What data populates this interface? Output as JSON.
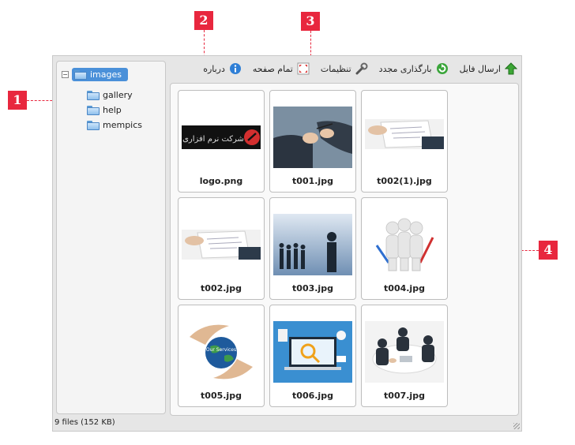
{
  "callouts": [
    "1",
    "2",
    "3",
    "4"
  ],
  "tree": {
    "root": "images",
    "expander": "−",
    "children": [
      "gallery",
      "help",
      "mempics"
    ]
  },
  "toolbar": {
    "upload_label": "ارسال فایل",
    "reload_label": "بارگذاری مجدد",
    "settings_label": "تنظیمات",
    "fullscreen_label": "تمام صفحه",
    "about_label": "درباره"
  },
  "files": [
    {
      "name": "logo.png",
      "thumb": "logo"
    },
    {
      "name": "t001.jpg",
      "thumb": "hands-pen"
    },
    {
      "name": "t002(1).jpg",
      "thumb": "hands-doc"
    },
    {
      "name": "t002.jpg",
      "thumb": "hands-doc"
    },
    {
      "name": "t003.jpg",
      "thumb": "business-people"
    },
    {
      "name": "t004.jpg",
      "thumb": "3d-figures"
    },
    {
      "name": "t005.jpg",
      "thumb": "globe-hands"
    },
    {
      "name": "t006.jpg",
      "thumb": "laptop-flat"
    },
    {
      "name": "t007.jpg",
      "thumb": "meeting"
    }
  ],
  "logo_text": "شرکت نرم افزاری",
  "services_text": "Our Services",
  "status": "9 files (152 KB)",
  "colors": {
    "callout": "#e8273e",
    "selection": "#4a90d9"
  }
}
